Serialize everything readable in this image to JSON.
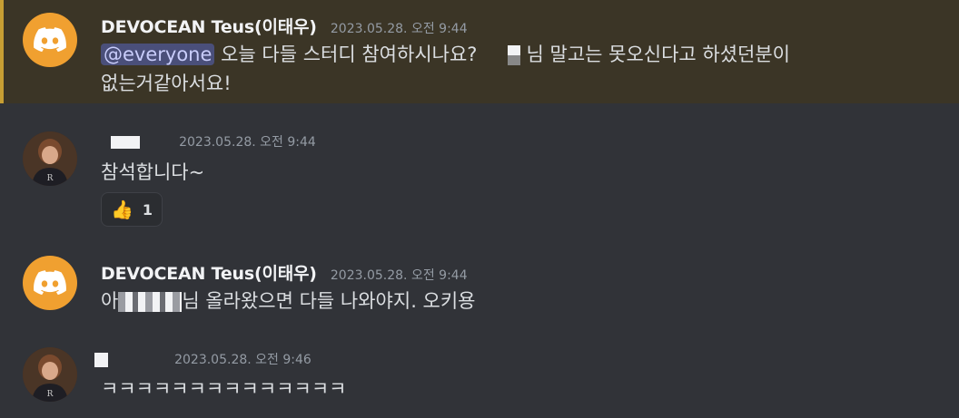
{
  "messages": [
    {
      "author": "DEVOCEAN Teus(이태우)",
      "timestamp": "2023.05.28. 오전 9:44",
      "mention": "@everyone",
      "text_part1": " 오늘 다들 스터디 참여하시나요?",
      "text_part2": "님 말고는 못오신다고 하셨던분이",
      "text_line2": "없는거같아서요!"
    },
    {
      "timestamp": "2023.05.28. 오전 9:44",
      "text": "참석합니다~",
      "reaction": {
        "emoji": "👍",
        "count": "1"
      }
    },
    {
      "author": "DEVOCEAN Teus(이태우)",
      "timestamp": "2023.05.28. 오전 9:44",
      "text_prefix": "아",
      "text_suffix": "님 올라왔으면 다들 나와야지. 오키용"
    },
    {
      "timestamp": "2023.05.28. 오전 9:46",
      "text": "ㅋㅋㅋㅋㅋㅋㅋㅋㅋㅋㅋㅋㅋㅋ"
    }
  ],
  "colors": {
    "background": "#313338",
    "mention_highlight": "#3b3526",
    "mention_bar": "#c79e33",
    "discord_avatar": "#f0a030"
  },
  "icons": [
    "discord-logo-icon",
    "user-avatar",
    "thumbs-up-emoji"
  ]
}
